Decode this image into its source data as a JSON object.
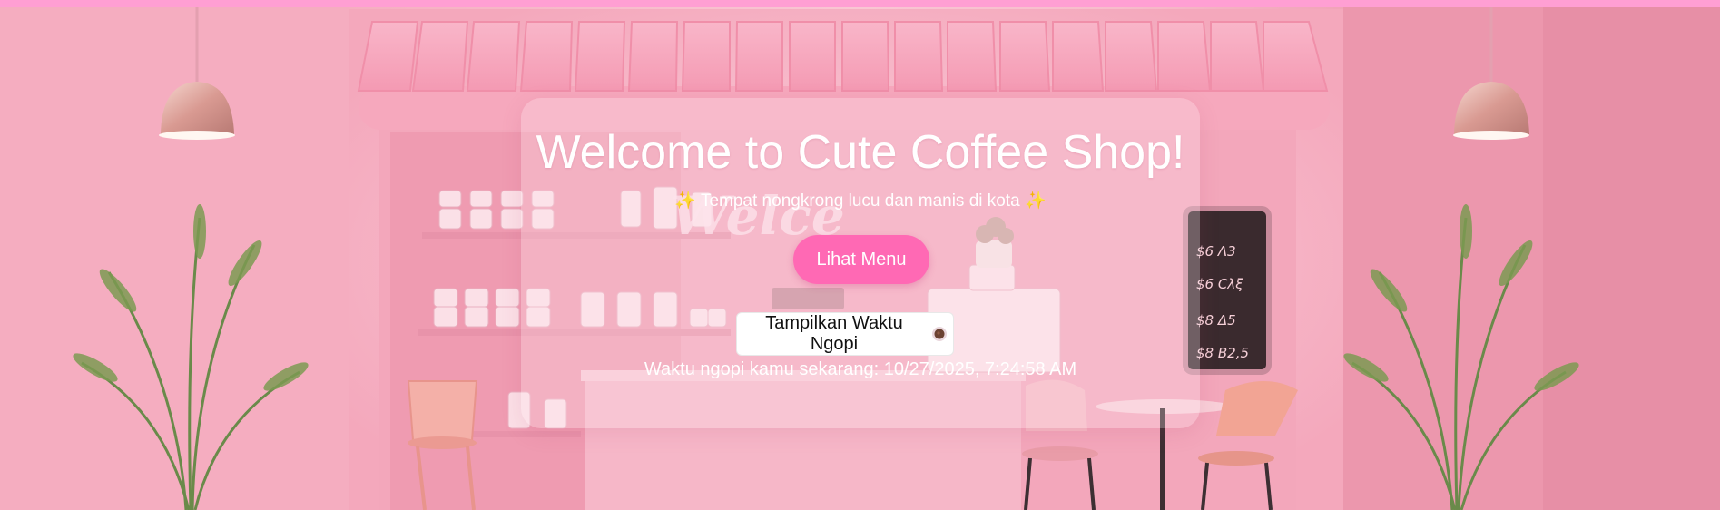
{
  "hero": {
    "title": "Welcome to Cute Coffee Shop!",
    "subtitle_spark_left": "✨",
    "subtitle_text": "Tempat nongkrong lucu dan manis di kota",
    "subtitle_spark_right": "✨",
    "menu_button_label": "Lihat Menu",
    "time_button_label": "Tampilkan Waktu Ngopi",
    "time_button_icon": "coffee-cup-icon",
    "time_prefix": "Waktu ngopi kamu sekarang: ",
    "time_value": "10/27/2025, 7:24:58 AM"
  },
  "background": {
    "sign_text": "Welce",
    "chalkboard_lines": [
      "$6 Λ3",
      "$6 Cλξ",
      "$8 Δ5",
      "$8 B2,5"
    ]
  },
  "colors": {
    "top_bar": "#ff9fd3",
    "menu_button": "#ff69b4",
    "text": "#ffffff",
    "time_button_bg": "#ffffff"
  }
}
